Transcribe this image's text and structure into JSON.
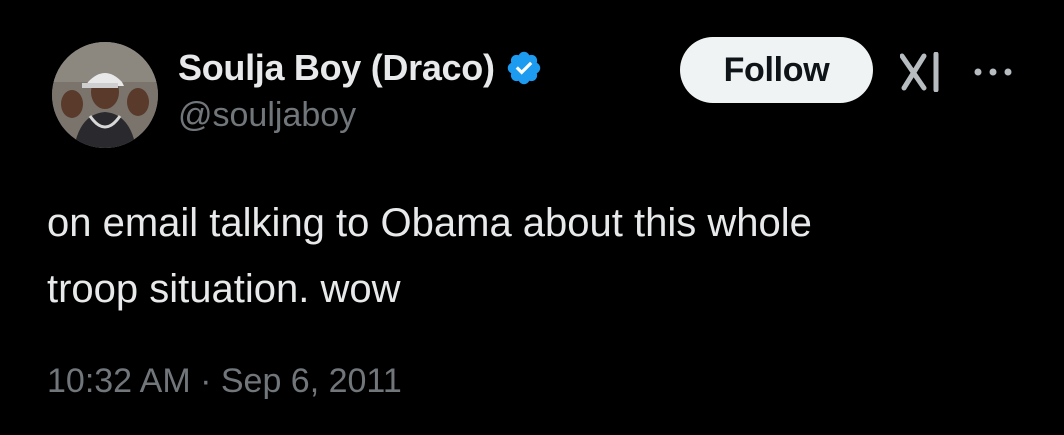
{
  "author": {
    "display_name": "Soulja Boy (Draco)",
    "handle": "@souljaboy",
    "verified": true,
    "avatar_icon": "profile-photo"
  },
  "actions": {
    "follow_label": "Follow",
    "grok_icon": "xai-grok-icon",
    "more_icon": "more-options-icon"
  },
  "tweet": {
    "text": "on email talking to Obama about this whole\ntroop situation. wow",
    "timestamp": "10:32 AM · Sep 6, 2011"
  },
  "colors": {
    "background": "#000000",
    "primary_text": "#e7e9ea",
    "secondary_text": "#71767b",
    "verified_badge": "#1d9bf0",
    "follow_button_bg": "#eff3f4"
  }
}
